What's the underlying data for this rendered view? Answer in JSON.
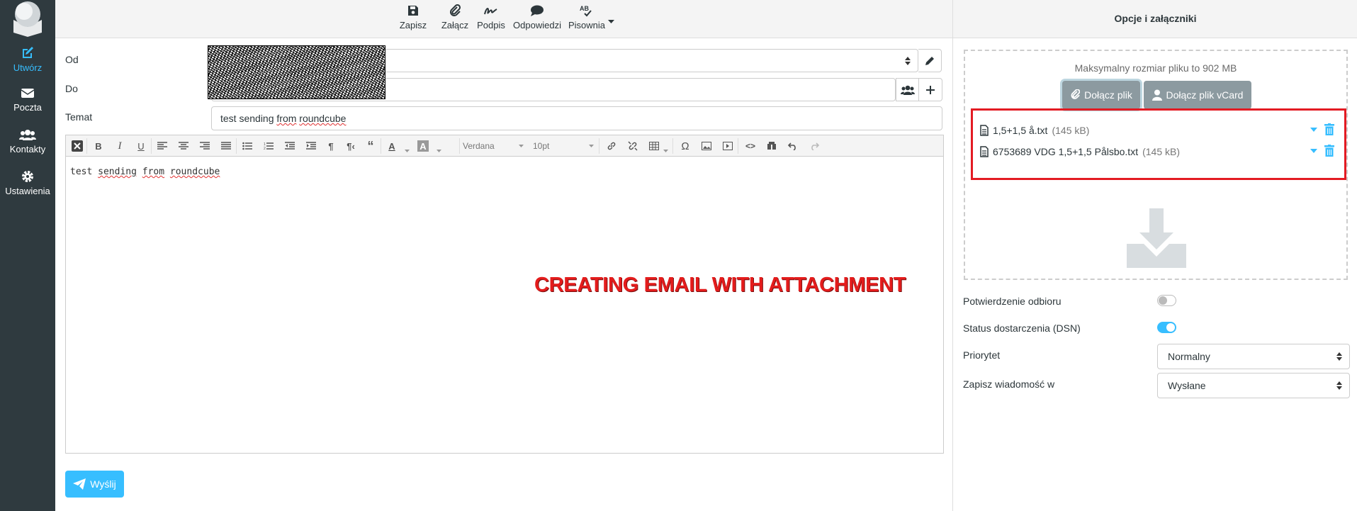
{
  "nav": {
    "items": [
      {
        "label": "Utwórz",
        "icon": "compose-icon",
        "active": true
      },
      {
        "label": "Poczta",
        "icon": "mail-icon",
        "active": false
      },
      {
        "label": "Kontakty",
        "icon": "contacts-icon",
        "active": false
      },
      {
        "label": "Ustawienia",
        "icon": "gear-icon",
        "active": false
      }
    ]
  },
  "toolbar": {
    "save": "Zapisz",
    "attach": "Załącz",
    "signature": "Podpis",
    "responses": "Odpowiedzi",
    "spell": "Pisownia"
  },
  "form": {
    "from_label": "Od",
    "to_label": "Do",
    "subject_label": "Temat",
    "subject_value": [
      "test sending ",
      "from",
      " ",
      "roundcube"
    ]
  },
  "editor": {
    "font": "Verdana",
    "size": "10pt",
    "body": [
      "test ",
      "sending",
      " ",
      "from",
      " ",
      "roundcube"
    ]
  },
  "overlay": "CREATING EMAIL WITH ATTACHMENT",
  "send_label": "Wyślij",
  "panel": {
    "title": "Opcje i załączniki",
    "max_size": "Maksymalny rozmiar pliku to 902 MB",
    "attach_file": "Dołącz plik",
    "attach_vcard": "Dołącz plik vCard",
    "attachments": [
      {
        "name": "1,5+1,5 å.txt",
        "size": "(145 kB)"
      },
      {
        "name": "6753689 VDG 1,5+1,5 Pålsbo.txt",
        "size": "(145 kB)"
      }
    ],
    "options": {
      "read_receipt": "Potwierdzenie odbioru",
      "read_receipt_on": false,
      "dsn": "Status dostarczenia (DSN)",
      "dsn_on": true,
      "priority_label": "Priorytet",
      "priority_value": "Normalny",
      "save_in_label": "Zapisz wiadomość w",
      "save_in_value": "Wysłane"
    }
  },
  "colors": {
    "accent": "#37beff",
    "nav_bg": "#2f3a3f",
    "highlight": "#e31b23"
  }
}
